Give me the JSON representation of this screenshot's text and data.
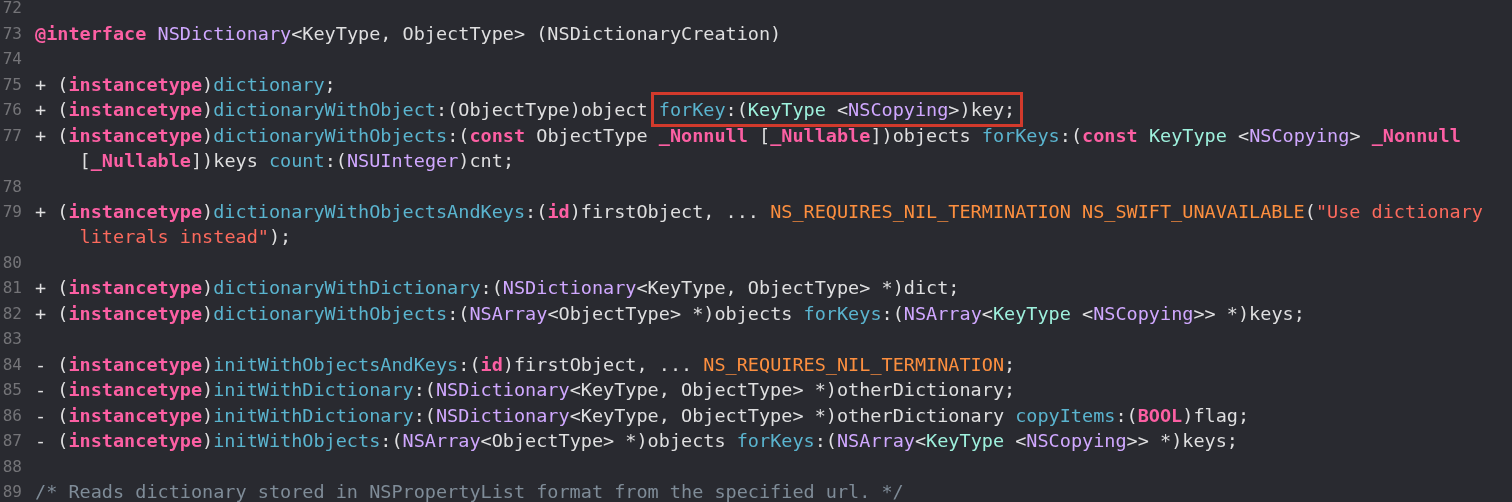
{
  "editor": {
    "lines": [
      {
        "number": "72"
      },
      {
        "number": "73",
        "tokens": [
          {
            "kind": "keyword",
            "text": "@interface"
          },
          {
            "kind": "class",
            "text": " NSDictionary"
          },
          {
            "kind": "plain",
            "text": "<KeyType, ObjectType> (NSDictionaryCreation)"
          }
        ]
      },
      {
        "number": "74"
      },
      {
        "number": "75",
        "tokens": [
          {
            "kind": "plain",
            "text": "+ ("
          },
          {
            "kind": "keyword",
            "text": "instancetype"
          },
          {
            "kind": "plain",
            "text": ")"
          },
          {
            "kind": "method",
            "text": "dictionary"
          },
          {
            "kind": "plain",
            "text": ";"
          }
        ]
      },
      {
        "number": "76",
        "tokens": [
          {
            "kind": "plain",
            "text": "+ ("
          },
          {
            "kind": "keyword",
            "text": "instancetype"
          },
          {
            "kind": "plain",
            "text": ")"
          },
          {
            "kind": "method",
            "text": "dictionaryWithObject"
          },
          {
            "kind": "plain",
            "text": ":(ObjectType)object "
          },
          {
            "kind": "highlight",
            "tokens": [
              {
                "kind": "method",
                "text": "forKey"
              },
              {
                "kind": "plain",
                "text": ":("
              },
              {
                "kind": "typeparam",
                "text": "KeyType"
              },
              {
                "kind": "plain",
                "text": " <"
              },
              {
                "kind": "class",
                "text": "NSCopying"
              },
              {
                "kind": "plain",
                "text": ">)key;"
              }
            ]
          }
        ]
      },
      {
        "number": "77",
        "tokens": [
          {
            "kind": "plain",
            "text": "+ ("
          },
          {
            "kind": "keyword",
            "text": "instancetype"
          },
          {
            "kind": "plain",
            "text": ")"
          },
          {
            "kind": "method",
            "text": "dictionaryWithObjects"
          },
          {
            "kind": "plain",
            "text": ":("
          },
          {
            "kind": "keyword",
            "text": "const"
          },
          {
            "kind": "plain",
            "text": " ObjectType "
          },
          {
            "kind": "keyword",
            "text": "_Nonnull"
          },
          {
            "kind": "plain",
            "text": " ["
          },
          {
            "kind": "keyword",
            "text": "_Nullable"
          },
          {
            "kind": "plain",
            "text": "])objects "
          },
          {
            "kind": "method",
            "text": "forKeys"
          },
          {
            "kind": "plain",
            "text": ":("
          },
          {
            "kind": "keyword",
            "text": "const"
          },
          {
            "kind": "typeparam",
            "text": " KeyType"
          },
          {
            "kind": "plain",
            "text": " <"
          },
          {
            "kind": "class",
            "text": "NSCopying"
          },
          {
            "kind": "plain",
            "text": "> "
          },
          {
            "kind": "keyword",
            "text": "_Nonnull"
          }
        ]
      },
      {
        "wrapped": true,
        "tokens": [
          {
            "kind": "plain",
            "text": "["
          },
          {
            "kind": "keyword",
            "text": "_Nullable"
          },
          {
            "kind": "plain",
            "text": "])keys "
          },
          {
            "kind": "method",
            "text": "count"
          },
          {
            "kind": "plain",
            "text": ":("
          },
          {
            "kind": "class",
            "text": "NSUInteger"
          },
          {
            "kind": "plain",
            "text": ")cnt;"
          }
        ]
      },
      {
        "number": "78"
      },
      {
        "number": "79",
        "tokens": [
          {
            "kind": "plain",
            "text": "+ ("
          },
          {
            "kind": "keyword",
            "text": "instancetype"
          },
          {
            "kind": "plain",
            "text": ")"
          },
          {
            "kind": "method",
            "text": "dictionaryWithObjectsAndKeys"
          },
          {
            "kind": "plain",
            "text": ":("
          },
          {
            "kind": "keyword",
            "text": "id"
          },
          {
            "kind": "plain",
            "text": ")firstObject, ... "
          },
          {
            "kind": "macro",
            "text": "NS_REQUIRES_NIL_TERMINATION NS_SWIFT_UNAVAILABLE"
          },
          {
            "kind": "plain",
            "text": "("
          },
          {
            "kind": "string",
            "text": "\"Use dictionary"
          }
        ]
      },
      {
        "wrapped": true,
        "tokens": [
          {
            "kind": "string",
            "text": "literals instead\""
          },
          {
            "kind": "plain",
            "text": ");"
          }
        ]
      },
      {
        "number": "80"
      },
      {
        "number": "81",
        "tokens": [
          {
            "kind": "plain",
            "text": "+ ("
          },
          {
            "kind": "keyword",
            "text": "instancetype"
          },
          {
            "kind": "plain",
            "text": ")"
          },
          {
            "kind": "method",
            "text": "dictionaryWithDictionary"
          },
          {
            "kind": "plain",
            "text": ":("
          },
          {
            "kind": "class",
            "text": "NSDictionary"
          },
          {
            "kind": "plain",
            "text": "<KeyType, ObjectType> *)dict;"
          }
        ]
      },
      {
        "number": "82",
        "tokens": [
          {
            "kind": "plain",
            "text": "+ ("
          },
          {
            "kind": "keyword",
            "text": "instancetype"
          },
          {
            "kind": "plain",
            "text": ")"
          },
          {
            "kind": "method",
            "text": "dictionaryWithObjects"
          },
          {
            "kind": "plain",
            "text": ":("
          },
          {
            "kind": "class",
            "text": "NSArray"
          },
          {
            "kind": "plain",
            "text": "<ObjectType> *)objects "
          },
          {
            "kind": "method",
            "text": "forKeys"
          },
          {
            "kind": "plain",
            "text": ":("
          },
          {
            "kind": "class",
            "text": "NSArray"
          },
          {
            "kind": "plain",
            "text": "<"
          },
          {
            "kind": "typeparam",
            "text": "KeyType"
          },
          {
            "kind": "plain",
            "text": " <"
          },
          {
            "kind": "class",
            "text": "NSCopying"
          },
          {
            "kind": "plain",
            "text": ">> *)keys;"
          }
        ]
      },
      {
        "number": "83"
      },
      {
        "number": "84",
        "tokens": [
          {
            "kind": "plain",
            "text": "- ("
          },
          {
            "kind": "keyword",
            "text": "instancetype"
          },
          {
            "kind": "plain",
            "text": ")"
          },
          {
            "kind": "method",
            "text": "initWithObjectsAndKeys"
          },
          {
            "kind": "plain",
            "text": ":("
          },
          {
            "kind": "keyword",
            "text": "id"
          },
          {
            "kind": "plain",
            "text": ")firstObject, ... "
          },
          {
            "kind": "macro",
            "text": "NS_REQUIRES_NIL_TERMINATION"
          },
          {
            "kind": "plain",
            "text": ";"
          }
        ]
      },
      {
        "number": "85",
        "tokens": [
          {
            "kind": "plain",
            "text": "- ("
          },
          {
            "kind": "keyword",
            "text": "instancetype"
          },
          {
            "kind": "plain",
            "text": ")"
          },
          {
            "kind": "method",
            "text": "initWithDictionary"
          },
          {
            "kind": "plain",
            "text": ":("
          },
          {
            "kind": "class",
            "text": "NSDictionary"
          },
          {
            "kind": "plain",
            "text": "<KeyType, ObjectType> *)otherDictionary;"
          }
        ]
      },
      {
        "number": "86",
        "tokens": [
          {
            "kind": "plain",
            "text": "- ("
          },
          {
            "kind": "keyword",
            "text": "instancetype"
          },
          {
            "kind": "plain",
            "text": ")"
          },
          {
            "kind": "method",
            "text": "initWithDictionary"
          },
          {
            "kind": "plain",
            "text": ":("
          },
          {
            "kind": "class",
            "text": "NSDictionary"
          },
          {
            "kind": "plain",
            "text": "<KeyType, ObjectType> *)otherDictionary "
          },
          {
            "kind": "method",
            "text": "copyItems"
          },
          {
            "kind": "plain",
            "text": ":("
          },
          {
            "kind": "keyword",
            "text": "BOOL"
          },
          {
            "kind": "plain",
            "text": ")flag;"
          }
        ]
      },
      {
        "number": "87",
        "tokens": [
          {
            "kind": "plain",
            "text": "- ("
          },
          {
            "kind": "keyword",
            "text": "instancetype"
          },
          {
            "kind": "plain",
            "text": ")"
          },
          {
            "kind": "method",
            "text": "initWithObjects"
          },
          {
            "kind": "plain",
            "text": ":("
          },
          {
            "kind": "class",
            "text": "NSArray"
          },
          {
            "kind": "plain",
            "text": "<ObjectType> *)objects "
          },
          {
            "kind": "method",
            "text": "forKeys"
          },
          {
            "kind": "plain",
            "text": ":("
          },
          {
            "kind": "class",
            "text": "NSArray"
          },
          {
            "kind": "plain",
            "text": "<"
          },
          {
            "kind": "typeparam",
            "text": "KeyType"
          },
          {
            "kind": "plain",
            "text": " <"
          },
          {
            "kind": "class",
            "text": "NSCopying"
          },
          {
            "kind": "plain",
            "text": ">> *)keys;"
          }
        ]
      },
      {
        "number": "88"
      },
      {
        "number": "89",
        "tokens": [
          {
            "kind": "comment",
            "text": "/* Reads dictionary stored in NSPropertyList format from the specified url. */"
          }
        ]
      }
    ]
  }
}
